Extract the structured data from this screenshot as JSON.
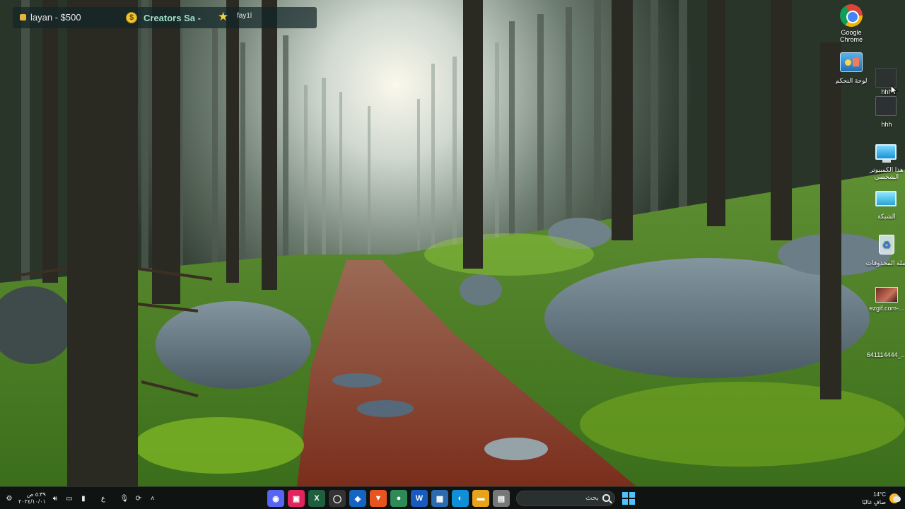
{
  "overlay": {
    "user_label": "layan - $500",
    "coin_symbol": "$",
    "creator_label": "Creators Sa - ",
    "star_icon": "★",
    "tag": "fay1l"
  },
  "desktop_icons": [
    {
      "name": "chrome",
      "label": "Google Chrome",
      "icon": "chrome-icon"
    },
    {
      "name": "control-panel",
      "label": "لوحة التحكم",
      "icon": "control-panel-icon"
    },
    {
      "name": "hhh-1",
      "label": "hhh",
      "icon": "file-icon"
    },
    {
      "name": "hhh-2",
      "label": "hhh",
      "icon": "file-icon"
    },
    {
      "name": "this-pc",
      "label": "هذا الكمبيوتر الشخصي",
      "icon": "computer-icon"
    },
    {
      "name": "network",
      "label": "الشبكة",
      "icon": "network-icon"
    },
    {
      "name": "recycle-bin",
      "label": "سلة المحذوفات",
      "icon": "recycle-bin-icon"
    },
    {
      "name": "ezgif",
      "label": "ezgif.com-...",
      "icon": "image-file-icon"
    },
    {
      "name": "file-641",
      "label": "641114444_...",
      "icon": "blank-file-icon"
    }
  ],
  "taskbar": {
    "clock_time": "٥:٣٩ ص",
    "clock_date": "٢٠٢٤/١٠/٠١",
    "lang": "ع",
    "apps": [
      {
        "name": "discord",
        "glyph": "◉",
        "color": "#5865f2"
      },
      {
        "name": "red-app",
        "glyph": "▣",
        "color": "#e0245e"
      },
      {
        "name": "excel-app",
        "glyph": "X",
        "color": "#1f5f3f"
      },
      {
        "name": "github-app",
        "glyph": "◯",
        "color": "#333333"
      },
      {
        "name": "outlook",
        "glyph": "◈",
        "color": "#1565c0"
      },
      {
        "name": "brave",
        "glyph": "▼",
        "color": "#e8541e"
      },
      {
        "name": "chrome",
        "glyph": "●",
        "color": "#2e8b57"
      },
      {
        "name": "word-app",
        "glyph": "W",
        "color": "#185abd"
      },
      {
        "name": "store",
        "glyph": "▦",
        "color": "#2b6cb0"
      },
      {
        "name": "edge",
        "glyph": "◐",
        "color": "#0f8fd8"
      },
      {
        "name": "explorer",
        "glyph": "▬",
        "color": "#e8a31a"
      },
      {
        "name": "notes",
        "glyph": "▤",
        "color": "#777777"
      }
    ],
    "search_placeholder": "بحث",
    "weather_temp": "14°C",
    "weather_desc": "صافٍ غالبًا"
  }
}
